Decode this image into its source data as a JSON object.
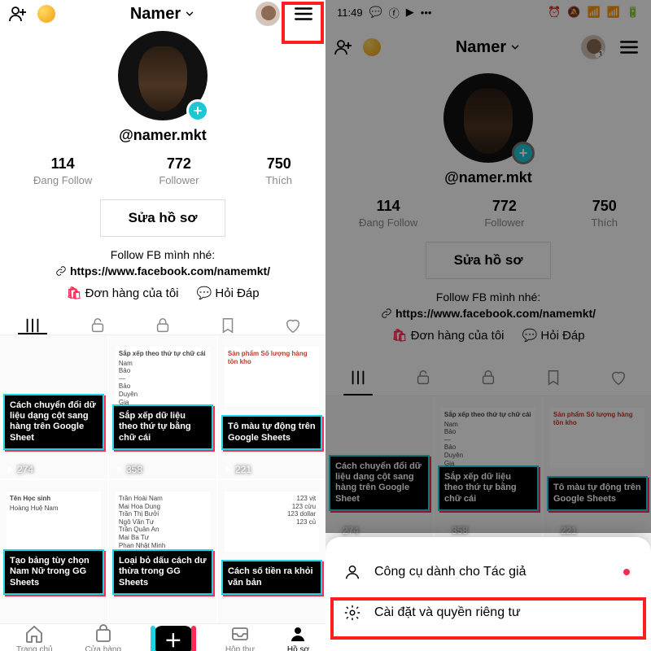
{
  "left": {
    "header": {
      "title": "Namer"
    },
    "profile": {
      "handle": "@namer.mkt",
      "stats": [
        {
          "num": "114",
          "lbl": "Đang Follow"
        },
        {
          "num": "772",
          "lbl": "Follower"
        },
        {
          "num": "750",
          "lbl": "Thích"
        }
      ],
      "edit": "Sửa hồ sơ",
      "bio": "Follow FB mình nhé:",
      "link": "https://www.facebook.com/namemkt/",
      "orders": "Đơn hàng của tôi",
      "faq": "Hỏi Đáp"
    },
    "videos_row1": [
      {
        "cap": "Cách chuyển đổi dữ liệu dạng cột sang hàng trên Google Sheet",
        "views": "274",
        "sheet_h": "",
        "sheet_b": ""
      },
      {
        "cap": "Sắp xếp dữ liệu theo thứ tự bằng chữ cái",
        "views": "358",
        "sheet_h": "Sắp xếp theo thứ tự chữ cái",
        "sheet_b": "Nam\nBảo\n—\nBảo\nDuyên\nGia\nKhải"
      },
      {
        "cap": "Tô màu tự động trên Google Sheets",
        "views": "221",
        "sheet_h": "Sản phẩm   Số lượng hàng tồn kho",
        "sheet_b": ""
      }
    ],
    "videos_row2": [
      {
        "cap": "Tạo bảng tùy chọn Nam Nữ trong GG Sheets",
        "views": "",
        "sheet_h": "Tên     Học sinh",
        "sheet_b": "Hoàng Huệ Nam"
      },
      {
        "cap": "Loại bỏ dấu cách dư thừa trong GG Sheets",
        "views": "",
        "sheet_h": "",
        "sheet_b": "Trần Hoài  Nam\nMai Hoa  Dung\nTrần  Thị Bưởi\nNgô Văn  Tư\nTrần Quân  An\nMai Ba  Tư\nPhan  Nhật Minh"
      },
      {
        "cap": "Cách số tiền ra khỏi văn bản",
        "views": "",
        "sheet_h": "",
        "sheet_b": "123 vịt\n123 cừu\n123 dollar\n123 củ"
      }
    ],
    "nav": {
      "home": "Trang chủ",
      "shop": "Cửa hàng",
      "inbox": "Hộp thư",
      "profile": "Hồ sơ"
    }
  },
  "right": {
    "status_time": "11:49",
    "avatar_badge": "1",
    "sheet": {
      "creator": "Công cụ dành cho Tác giả",
      "settings": "Cài đặt và quyền riêng tư"
    }
  }
}
